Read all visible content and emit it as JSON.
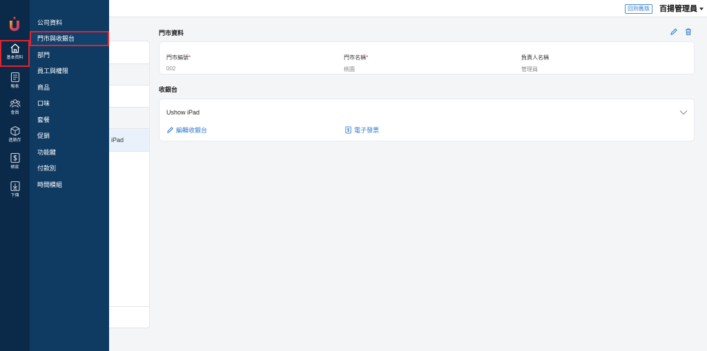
{
  "header": {
    "back_to_old": "回到舊版",
    "user_name": "百揚管理員"
  },
  "rail": {
    "items": [
      {
        "label": "基本資料",
        "icon": "home-icon"
      },
      {
        "label": "報表",
        "icon": "report-icon"
      },
      {
        "label": "會員",
        "icon": "members-icon"
      },
      {
        "label": "進銷存",
        "icon": "inventory-icon"
      },
      {
        "label": "帳款",
        "icon": "dollar-icon"
      },
      {
        "label": "下傳",
        "icon": "download-icon"
      }
    ]
  },
  "submenu": {
    "items": [
      {
        "label": "公司資料"
      },
      {
        "label": "門市與收銀台"
      },
      {
        "label": "部門"
      },
      {
        "label": "員工與權限"
      },
      {
        "label": "商品"
      },
      {
        "label": "口味"
      },
      {
        "label": "套餐"
      },
      {
        "label": "促銷"
      },
      {
        "label": "功能鍵"
      },
      {
        "label": "付款別"
      },
      {
        "label": "時間模組"
      }
    ]
  },
  "left_list": {
    "selected_text": "iPad"
  },
  "store": {
    "title": "門市資料",
    "fields": [
      {
        "label": "門市編號",
        "required": "*",
        "value": "002"
      },
      {
        "label": "門市名稱",
        "required": "*",
        "value": "桃園"
      },
      {
        "label": "負責人名稱",
        "required": "",
        "value": "管理員"
      }
    ]
  },
  "registers": {
    "title": "收銀台",
    "items": [
      {
        "name": "Ushow iPad",
        "edit_label": "編輯收銀台",
        "invoice_label": "電子發票"
      }
    ]
  },
  "colors": {
    "rail_bg": "#0b2a4a",
    "submenu_bg": "#0f3a62",
    "accent": "#2f7ad0",
    "highlight": "#e0252e"
  }
}
